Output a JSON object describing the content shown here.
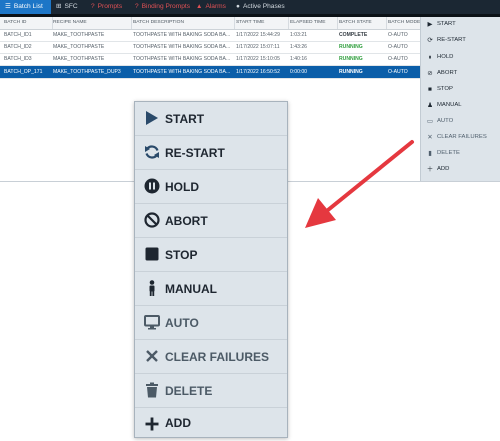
{
  "tabs": [
    {
      "label": "Batch List",
      "icon": "list-icon",
      "glyph": "☰",
      "active": true
    },
    {
      "label": "SFC",
      "icon": "sitemap-icon",
      "glyph": "⊞",
      "active": false
    },
    {
      "label": "Prompts",
      "icon": "question-icon",
      "glyph": "?",
      "active": false,
      "warn": true
    },
    {
      "label": "Binding Prompts",
      "icon": "question-icon",
      "glyph": "?",
      "active": false,
      "warn": true
    },
    {
      "label": "Alarms",
      "icon": "bell-icon",
      "glyph": "▲",
      "active": false,
      "warn": true
    },
    {
      "label": "Active Phases",
      "icon": "user-icon",
      "glyph": "●",
      "active": false
    }
  ],
  "table": {
    "columns": [
      "BATCH ID",
      "RECIPE NAME",
      "BATCH DESCRIPTION",
      "START TIME",
      "ELAPSED TIME",
      "BATCH STATE",
      "BATCH MODE"
    ],
    "rows": [
      [
        "BATCH_ID1",
        "MAKE_TOOTHPASTE",
        "TOOTHPASTE WITH BAKING SODA BA...",
        "1/17/2022 15:44:29",
        "1:03:21",
        "COMPLETE",
        "O-AUTO"
      ],
      [
        "BATCH_ID2",
        "MAKE_TOOTHPASTE",
        "TOOTHPASTE WITH BAKING SODA BA...",
        "1/17/2022 15:07:11",
        "1:43:26",
        "RUNNING",
        "O-AUTO"
      ],
      [
        "BATCH_ID3",
        "MAKE_TOOTHPASTE",
        "TOOTHPASTE WITH BAKING SODA BA...",
        "1/17/2022 15:10:05",
        "1:40:16",
        "RUNNING",
        "O-AUTO"
      ],
      [
        "BATCH_OP_171",
        "MAKE_TOOTHPASTE_DUP3",
        "TOOTHPASTE WITH BAKING SODA BA...",
        "1/17/2022 16:50:52",
        "0:00:00",
        "RUNNING",
        "O-AUTO"
      ]
    ],
    "selected_row": 3
  },
  "commands": [
    {
      "label": "START",
      "icon": "play-icon",
      "enabled": true
    },
    {
      "label": "RE-START",
      "icon": "refresh-icon",
      "enabled": true
    },
    {
      "label": "HOLD",
      "icon": "pause-icon",
      "enabled": true
    },
    {
      "label": "ABORT",
      "icon": "ban-icon",
      "enabled": true
    },
    {
      "label": "STOP",
      "icon": "stop-icon",
      "enabled": true
    },
    {
      "label": "MANUAL",
      "icon": "person-icon",
      "enabled": true
    },
    {
      "label": "AUTO",
      "icon": "monitor-icon",
      "enabled": false
    },
    {
      "label": "CLEAR FAILURES",
      "icon": "close-icon",
      "enabled": false
    },
    {
      "label": "DELETE",
      "icon": "trash-icon",
      "enabled": false
    },
    {
      "label": "ADD",
      "icon": "plus-icon",
      "enabled": true
    }
  ],
  "colors": {
    "accent": "#1d76c7",
    "selected_row": "#0b5ea9",
    "running": "#2e9e3c",
    "callout_arrow": "#e5383f",
    "panel_bg": "#dde4ea"
  }
}
